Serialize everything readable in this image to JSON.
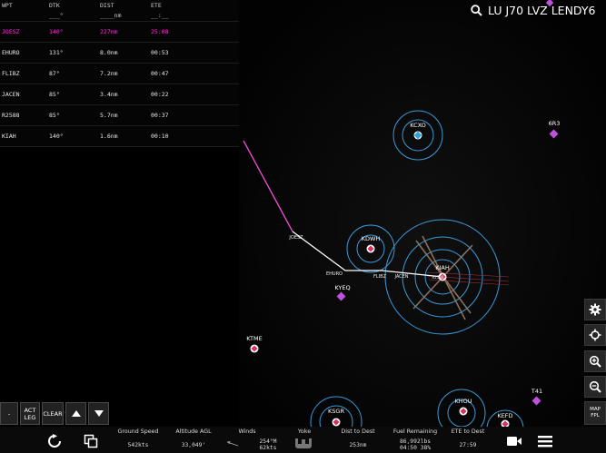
{
  "flight_plan": {
    "headers": {
      "wpt": "WPT",
      "dtk": "DTK",
      "dist": "DIST",
      "ete": "ETE"
    },
    "blank_row": {
      "wpt": "",
      "dtk": "___°",
      "dist": "____nm",
      "ete": "__:__"
    },
    "rows": [
      {
        "wpt": "JOESZ",
        "dtk": "140°",
        "dist": "227nm",
        "ete": "25:08",
        "active": true
      },
      {
        "wpt": "EHURO",
        "dtk": "131°",
        "dist": "8.0nm",
        "ete": "00:53"
      },
      {
        "wpt": "FLIBZ",
        "dtk": "87°",
        "dist": "7.2nm",
        "ete": "00:47"
      },
      {
        "wpt": "JACEN",
        "dtk": "85°",
        "dist": "3.4nm",
        "ete": "00:22"
      },
      {
        "wpt": "R2588",
        "dtk": "85°",
        "dist": "5.7nm",
        "ete": "00:37"
      },
      {
        "wpt": "KIAH",
        "dtk": "140°",
        "dist": "1.6nm",
        "ete": "00:10"
      }
    ]
  },
  "search": {
    "text": "LU J70 LVZ LENDY6",
    "icon": "search-icon"
  },
  "map": {
    "airports": [
      {
        "id": "KCXO",
        "kind": "towered"
      },
      {
        "id": "KDWH",
        "kind": "towered"
      },
      {
        "id": "KIAH",
        "kind": "towered"
      },
      {
        "id": "KYEQ",
        "kind": "non-towered"
      },
      {
        "id": "6R3",
        "kind": "non-towered"
      },
      {
        "id": "KTME",
        "kind": "towered"
      },
      {
        "id": "KSGR",
        "kind": "towered"
      },
      {
        "id": "KHOU",
        "kind": "towered"
      },
      {
        "id": "KEFD",
        "kind": "towered"
      },
      {
        "id": "T41",
        "kind": "non-towered"
      }
    ],
    "route_waypoints": [
      "JOESZ",
      "EHURO",
      "FLIBZ",
      "JACEN",
      "R2588"
    ],
    "colors": {
      "active_leg": "#ff4fe0",
      "route": "#ffffff",
      "airspace": "#3a9ad9",
      "nontowered": "#c050e0",
      "towered_fill": "#d83060"
    }
  },
  "toolbar": {
    "settings_icon": "gear-icon",
    "center_icon": "crosshair-icon",
    "zoom_in_icon": "zoom-in-icon",
    "zoom_out_icon": "zoom-out-icon",
    "map_fpl_line1": "MAP",
    "map_fpl_line2": "FPL"
  },
  "fpl_controls": {
    "dash": "-",
    "act_leg_line1": "ACT",
    "act_leg_line2": "LEG",
    "clear": "CLEAR"
  },
  "stats": {
    "ground_speed": {
      "label": "Ground Speed",
      "value": "542kts"
    },
    "altitude": {
      "label": "Altitude AGL",
      "value": "33,049'"
    },
    "winds": {
      "label": "Winds",
      "value1": "254°M",
      "value2": "62kts"
    },
    "yoke": {
      "label": "Yoke"
    },
    "dist_to_dest": {
      "label": "Dist to Dest",
      "value": "253nm"
    },
    "fuel": {
      "label": "Fuel Remaining",
      "value1": "86,992lbs",
      "value2": "04:50 38%"
    },
    "ete_to_dest": {
      "label": "ETE to Dest",
      "value": "27:59"
    }
  }
}
